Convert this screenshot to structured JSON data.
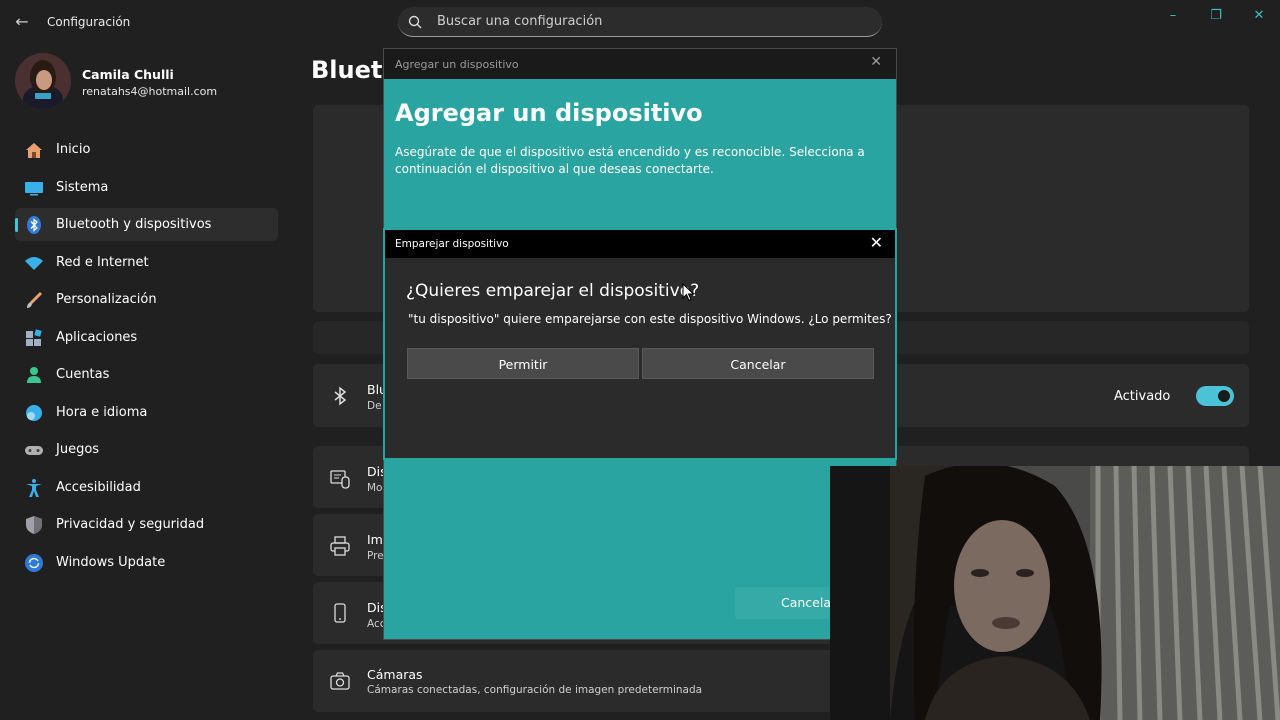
{
  "app": {
    "title": "Configuración",
    "search_placeholder": "Buscar una configuración",
    "minimize": "–",
    "maximize": "❐",
    "close": "✕"
  },
  "profile": {
    "name": "Camila Chulli",
    "email": "renatahs4@hotmail.com"
  },
  "sidebar": {
    "items": [
      {
        "label": "Inicio",
        "icon": "home-icon"
      },
      {
        "label": "Sistema",
        "icon": "system-icon"
      },
      {
        "label": "Bluetooth y dispositivos",
        "icon": "bluetooth-icon",
        "active": true
      },
      {
        "label": "Red e Internet",
        "icon": "wifi-icon"
      },
      {
        "label": "Personalización",
        "icon": "brush-icon"
      },
      {
        "label": "Aplicaciones",
        "icon": "apps-icon"
      },
      {
        "label": "Cuentas",
        "icon": "account-icon"
      },
      {
        "label": "Hora e idioma",
        "icon": "clock-globe-icon"
      },
      {
        "label": "Juegos",
        "icon": "gamepad-icon"
      },
      {
        "label": "Accesibilidad",
        "icon": "accessibility-icon"
      },
      {
        "label": "Privacidad y seguridad",
        "icon": "shield-icon"
      },
      {
        "label": "Windows Update",
        "icon": "update-icon"
      }
    ]
  },
  "main": {
    "page_title": "Blueto",
    "bluetooth_row": {
      "title": "Blu",
      "sub": "De",
      "toggle_label": "Activado",
      "toggle_on": true
    },
    "rows": [
      {
        "title": "Dis",
        "sub": "Mo",
        "icon": "keyboard-mouse-icon"
      },
      {
        "title": "Im",
        "sub": "Pre",
        "icon": "printer-icon"
      },
      {
        "title": "Dis",
        "sub": "Acc",
        "icon": "phone-icon"
      },
      {
        "title": "Cámaras",
        "sub": "Cámaras conectadas, configuración de imagen predeterminada",
        "icon": "camera-icon"
      }
    ]
  },
  "add_device_dialog": {
    "window_title": "Agregar un dispositivo",
    "heading": "Agregar un dispositivo",
    "description": "Asegúrate de que el dispositivo está encendido y es reconocible. Selecciona a continuación el dispositivo al que deseas conectarte.",
    "cancel_label": "Cancelar",
    "accent": "#2aa4a0"
  },
  "pair_dialog": {
    "window_title": "Emparejar dispositivo",
    "question": "¿Quieres emparejar el dispositivo?",
    "message": "\"tu dispositivo\" quiere emparejarse con este dispositivo Windows. ¿Lo permites?",
    "allow_label": "Permitir",
    "cancel_label": "Cancelar"
  },
  "colors": {
    "background": "#202020",
    "card": "#2b2b2b",
    "accent": "#4cc2d6",
    "dialog_teal": "#2aa4a0"
  }
}
